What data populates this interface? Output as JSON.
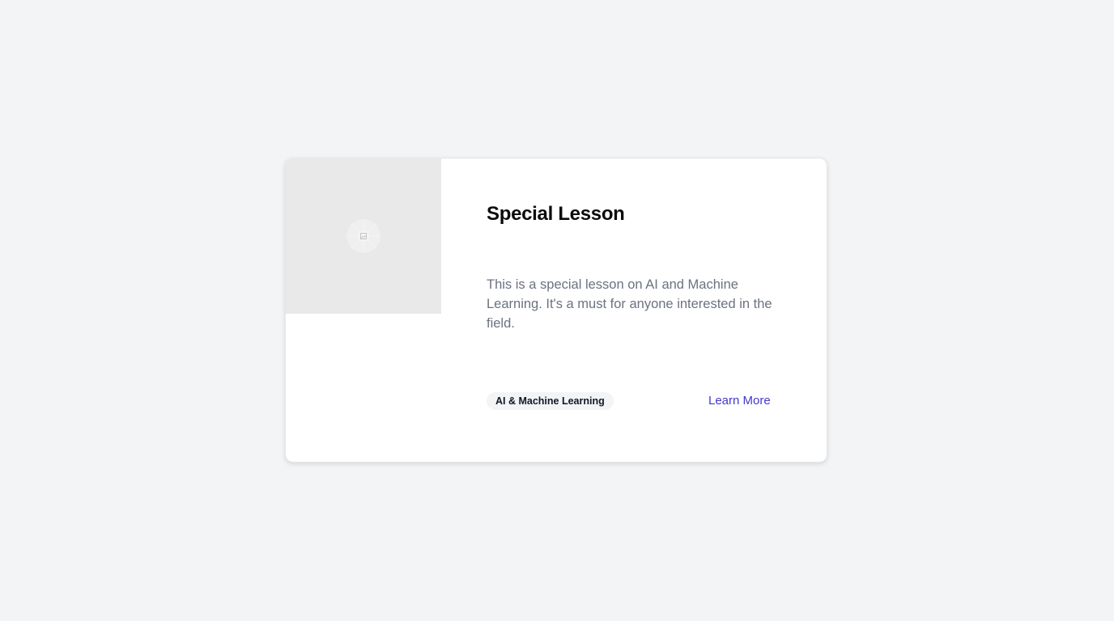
{
  "card": {
    "title": "Special Lesson",
    "description": "This is a special lesson on AI and Machine Learning. It's a must for anyone interested in the field.",
    "tag": "AI & Machine Learning",
    "link_label": "Learn More",
    "image_icon": "image-placeholder-icon"
  },
  "colors": {
    "background": "#f3f4f6",
    "card": "#ffffff",
    "thumbnail": "#e9e9e9",
    "title": "#0b0b0b",
    "description": "#6b7280",
    "tag_background": "#f3f4f6",
    "link": "#4338ca"
  }
}
